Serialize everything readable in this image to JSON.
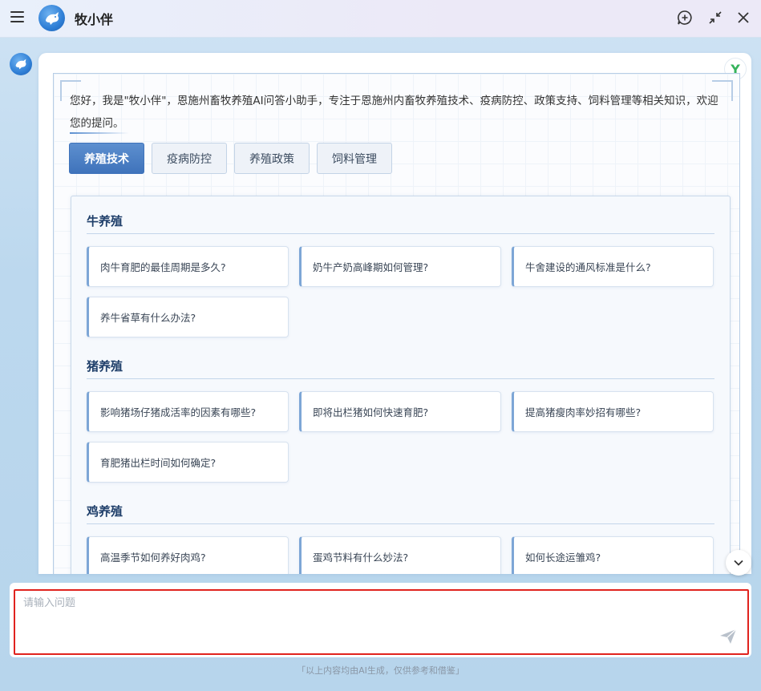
{
  "app": {
    "title": "牧小伴"
  },
  "intro": "您好，我是\"牧小伴\"，恩施州畜牧养殖AI问答小助手，专注于恩施州内畜牧养殖技术、疫病防控、政策支持、饲料管理等相关知识，欢迎您的提问。",
  "badge": "Y",
  "tabs": [
    {
      "label": "养殖技术",
      "active": true
    },
    {
      "label": "疫病防控",
      "active": false
    },
    {
      "label": "养殖政策",
      "active": false
    },
    {
      "label": "饲料管理",
      "active": false
    }
  ],
  "sections": [
    {
      "title": "牛养殖",
      "questions": [
        "肉牛育肥的最佳周期是多久?",
        "奶牛产奶高峰期如何管理?",
        "牛舍建设的通风标准是什么?",
        "养牛省草有什么办法?"
      ]
    },
    {
      "title": "猪养殖",
      "questions": [
        "影响猪场仔猪成活率的因素有哪些?",
        "即将出栏猪如何快速育肥?",
        "提高猪瘦肉率妙招有哪些?",
        "育肥猪出栏时间如何确定?"
      ]
    },
    {
      "title": "鸡养殖",
      "questions": [
        "高温季节如何养好肉鸡?",
        "蛋鸡节料有什么妙法?",
        "如何长途运雏鸡?"
      ]
    }
  ],
  "input": {
    "placeholder": "请输入问题",
    "value": ""
  },
  "footer": "「以上内容均由AI生成，仅供参考和借鉴」",
  "colors": {
    "accent": "#3f73bb",
    "highlight_border": "#e0231e",
    "section_title": "#1f3f6a"
  }
}
